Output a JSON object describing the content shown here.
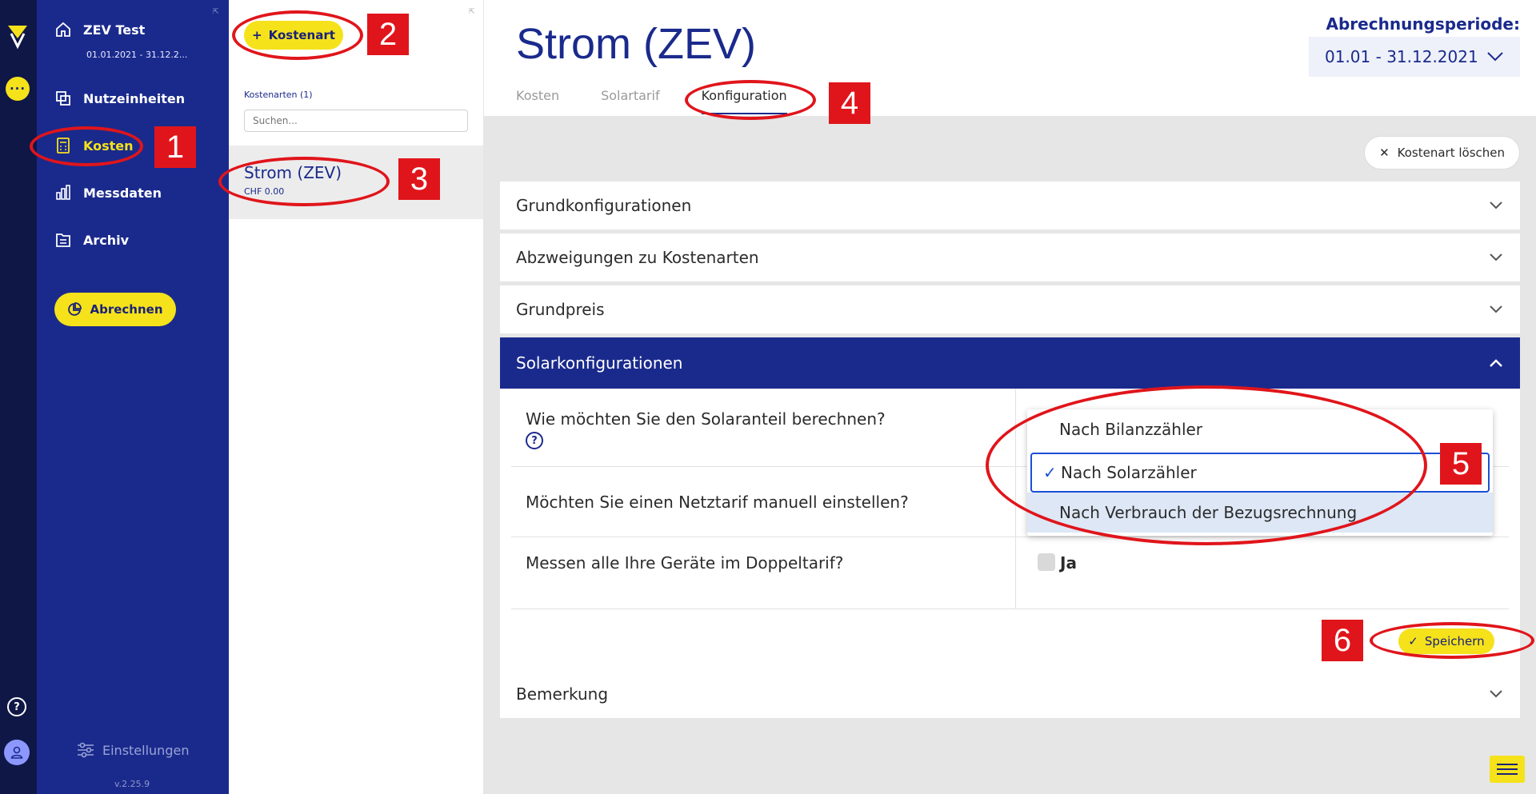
{
  "sidebar": {
    "project_name": "ZEV Test",
    "project_dates": "01.01.2021 - 31.12.2...",
    "items": [
      {
        "label": "Nutzeinheiten"
      },
      {
        "label": "Kosten"
      },
      {
        "label": "Messdaten"
      },
      {
        "label": "Archiv"
      }
    ],
    "abrechnen_label": "Abrechnen",
    "settings_label": "Einstellungen",
    "version": "v.2.25.9"
  },
  "list": {
    "add_button_label": "Kostenart",
    "header": "Kostenarten (1)",
    "search_placeholder": "Suchen...",
    "items": [
      {
        "title": "Strom (ZEV)",
        "amount": "CHF 0.00"
      }
    ]
  },
  "main": {
    "title": "Strom (ZEV)",
    "tabs": [
      {
        "label": "Kosten"
      },
      {
        "label": "Solartarif"
      },
      {
        "label": "Konfiguration"
      }
    ],
    "period_label": "Abrechnungsperiode:",
    "period_value": "01.01 - 31.12.2021",
    "delete_label": "Kostenart löschen",
    "sections": [
      {
        "label": "Grundkonfigurationen"
      },
      {
        "label": "Abzweigungen zu Kostenarten"
      },
      {
        "label": "Grundpreis"
      },
      {
        "label": "Solarkonfigurationen"
      },
      {
        "label": "Bemerkung"
      }
    ],
    "questions": [
      {
        "label": "Wie möchten Sie den Solaranteil berechnen?"
      },
      {
        "label": "Möchten Sie einen Netztarif manuell einstellen?"
      },
      {
        "label": "Messen alle Ihre Geräte im Doppeltarif?"
      }
    ],
    "checkbox_label": "Ja",
    "dropdown_options": [
      {
        "label": "Nach Bilanzzähler"
      },
      {
        "label": "Nach Solarzähler"
      },
      {
        "label": "Nach Verbrauch der Bezugsrechnung"
      }
    ],
    "save_label": "Speichern"
  },
  "annotations": [
    "1",
    "2",
    "3",
    "4",
    "5",
    "6"
  ],
  "colors": {
    "brand_blue": "#1a2a8c",
    "accent_yellow": "#f5e21b",
    "annotation_red": "#e0151b"
  }
}
